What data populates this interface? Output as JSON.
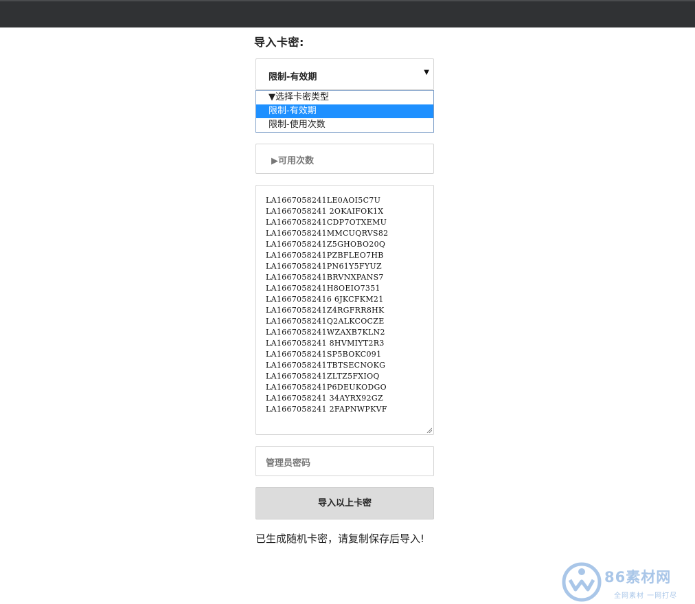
{
  "header": {
    "title": "导入卡密:"
  },
  "type_select": {
    "selected": "限制-有效期",
    "options": [
      "▼选择卡密类型",
      "限制-有效期",
      "限制-使用次数"
    ]
  },
  "count_field": {
    "placeholder": "▶可用次数"
  },
  "codes": [
    "LA1667058241LE0AOI5C7U",
    "LA1667058241 2OKAIFOK1X",
    "LA1667058241CDP7OTXEMU",
    "LA1667058241MMCUQRVS82",
    "LA1667058241Z5GHOBO20Q",
    "LA1667058241PZBFLEO7HB",
    "LA1667058241PN61Y5FYUZ",
    "LA1667058241BRVNXPANS7",
    "LA1667058241H8OEIO7351",
    "LA16670582416 6JKCFKM21",
    "LA1667058241Z4RGFRR8HK",
    "LA1667058241Q2ALKCOCZE",
    "LA1667058241WZAXB7KLN2",
    "LA1667058241 8HVMIYT2R3",
    "LA1667058241SP5BOKC091",
    "LA1667058241TBTSECNOKG",
    "LA1667058241ZLTZ5FXIOQ",
    "LA1667058241P6DEUKODGO",
    "LA1667058241 34AYRX92GZ",
    "LA1667058241 2FAPNWPKVF"
  ],
  "password_field": {
    "placeholder": "管理员密码"
  },
  "submit": {
    "label": "导入以上卡密"
  },
  "status": {
    "text": "已生成随机卡密，请复制保存后导入!"
  },
  "watermark": {
    "title": "86素材网",
    "subtitle": "全网素材 一网打尽"
  },
  "colors": {
    "topbar": "#303234",
    "selected_option": "#1e90ff",
    "button": "#dcdcdc"
  }
}
